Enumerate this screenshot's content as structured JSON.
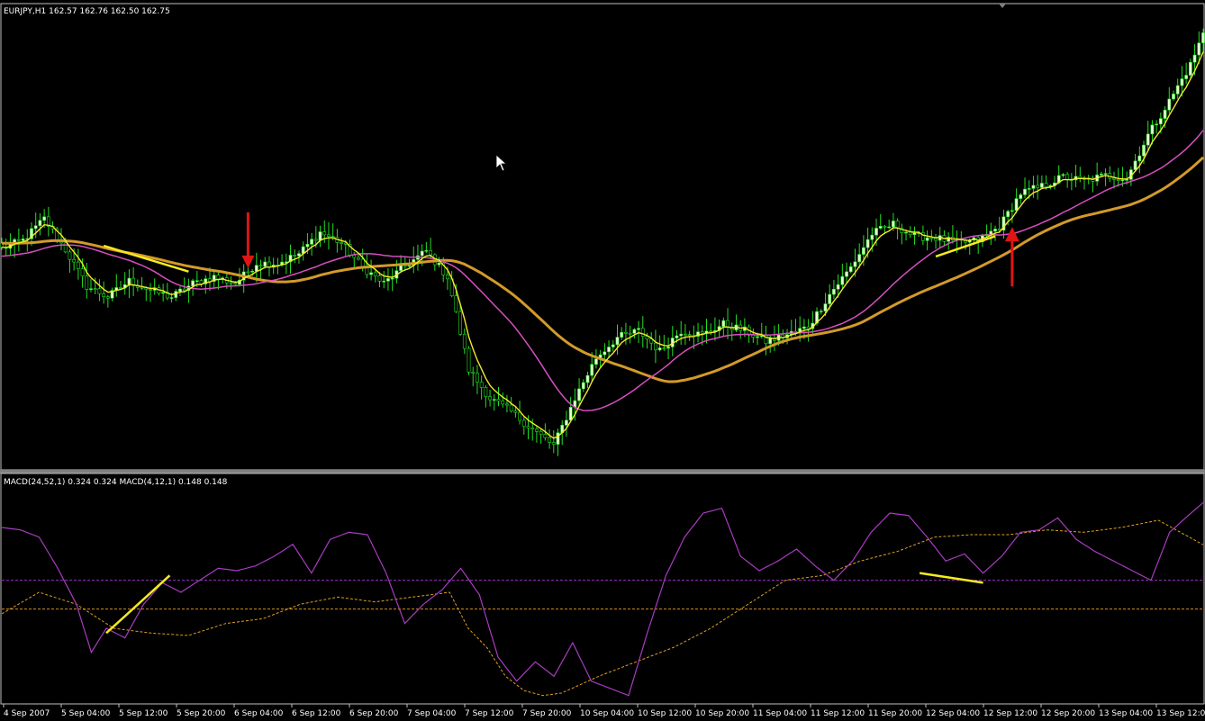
{
  "window": {
    "symbol_info": "EURJPY,H1  162.57 162.76 162.50 162.75",
    "indicator_info": "MACD(24,52,1) 0.324 0.324  MACD(4,12,1) 0.148 0.148"
  },
  "colors": {
    "background": "#000000",
    "frame": "#c0c0c0",
    "candle_up": "#e6ffd0",
    "candle_down": "#000000",
    "wick": "#22e022",
    "ma_fast": "#f2ea28",
    "ma_mid": "#d64fbf",
    "ma_slow": "#d39a2a",
    "annotation_line": "#f5ea20",
    "arrow": "#e11414",
    "macd_fast": "#a83cc0",
    "macd_slow": "#e0a020",
    "macd_level_upper": "#9b30c0",
    "macd_level_lower": "#d49020"
  },
  "chart_data": [
    {
      "type": "candlestick",
      "symbol": "EURJPY",
      "timeframe": "H1",
      "ohlc_header": {
        "open": 162.57,
        "high": 162.76,
        "low": 162.5,
        "close": 162.75
      },
      "x_tick_labels": [
        "4 Sep 2007",
        "5 Sep 04:00",
        "5 Sep 12:00",
        "5 Sep 20:00",
        "6 Sep 04:00",
        "6 Sep 12:00",
        "6 Sep 20:00",
        "7 Sep 04:00",
        "7 Sep 12:00",
        "7 Sep 20:00",
        "10 Sep 04:00",
        "10 Sep 12:00",
        "10 Sep 20:00",
        "11 Sep 04:00",
        "11 Sep 12:00",
        "11 Sep 20:00",
        "12 Sep 04:00",
        "12 Sep 12:00",
        "12 Sep 20:00",
        "13 Sep 04:00",
        "13 Sep 12:00"
      ],
      "y_range": [
        159.6,
        162.8
      ],
      "close_profile": [
        [
          0,
          161.16
        ],
        [
          5,
          161.22
        ],
        [
          10,
          161.38
        ],
        [
          15,
          161.15
        ],
        [
          20,
          160.88
        ],
        [
          25,
          160.8
        ],
        [
          30,
          160.92
        ],
        [
          35,
          160.85
        ],
        [
          40,
          160.8
        ],
        [
          45,
          160.9
        ],
        [
          50,
          160.95
        ],
        [
          55,
          160.9
        ],
        [
          60,
          161.05
        ],
        [
          65,
          161.05
        ],
        [
          70,
          161.12
        ],
        [
          75,
          161.28
        ],
        [
          80,
          161.2
        ],
        [
          85,
          161.02
        ],
        [
          90,
          160.9
        ],
        [
          95,
          161.03
        ],
        [
          100,
          161.14
        ],
        [
          105,
          160.95
        ],
        [
          110,
          160.26
        ],
        [
          115,
          160.05
        ],
        [
          120,
          159.95
        ],
        [
          125,
          159.82
        ],
        [
          130,
          159.7
        ],
        [
          135,
          160.05
        ],
        [
          140,
          160.35
        ],
        [
          145,
          160.5
        ],
        [
          150,
          160.55
        ],
        [
          155,
          160.4
        ],
        [
          160,
          160.55
        ],
        [
          165,
          160.52
        ],
        [
          170,
          160.6
        ],
        [
          175,
          160.55
        ],
        [
          180,
          160.47
        ],
        [
          185,
          160.52
        ],
        [
          190,
          160.58
        ],
        [
          195,
          160.82
        ],
        [
          200,
          161.02
        ],
        [
          205,
          161.27
        ],
        [
          210,
          161.34
        ],
        [
          215,
          161.25
        ],
        [
          220,
          161.24
        ],
        [
          225,
          161.2
        ],
        [
          230,
          161.22
        ],
        [
          235,
          161.32
        ],
        [
          240,
          161.57
        ],
        [
          245,
          161.62
        ],
        [
          250,
          161.69
        ],
        [
          255,
          161.66
        ],
        [
          260,
          161.7
        ],
        [
          265,
          161.68
        ],
        [
          270,
          162.0
        ],
        [
          275,
          162.25
        ],
        [
          280,
          162.52
        ],
        [
          283,
          162.75
        ]
      ],
      "moving_averages": [
        "fast",
        "mid",
        "slow"
      ],
      "annotations": [
        {
          "kind": "sell-arrow",
          "near": "5 Sep 20:00"
        },
        {
          "kind": "buy-arrow",
          "near": "12 Sep 12:00"
        }
      ]
    },
    {
      "type": "line",
      "title": "MACD(24,52,1) 0.324 0.324  MACD(4,12,1) 0.148 0.148",
      "series": [
        {
          "name": "MACD(24,52,1)",
          "last_value": 0.324
        },
        {
          "name": "MACD(4,12,1)",
          "last_value": 0.148
        }
      ],
      "x_tick_labels": [
        "4 Sep 2007",
        "5 Sep 04:00",
        "5 Sep 12:00",
        "5 Sep 20:00",
        "6 Sep 04:00",
        "6 Sep 12:00",
        "6 Sep 20:00",
        "7 Sep 04:00",
        "7 Sep 12:00",
        "7 Sep 20:00",
        "10 Sep 04:00",
        "10 Sep 12:00",
        "10 Sep 20:00",
        "11 Sep 04:00",
        "11 Sep 12:00",
        "11 Sep 20:00",
        "12 Sep 04:00",
        "12 Sep 12:00",
        "12 Sep 20:00",
        "13 Sep 04:00",
        "13 Sep 12:00"
      ],
      "y_range": [
        -0.5,
        0.4
      ],
      "fast_profile": [
        [
          0,
          0.22
        ],
        [
          5,
          0.21
        ],
        [
          10,
          0.18
        ],
        [
          15,
          0.05
        ],
        [
          20,
          -0.1
        ],
        [
          24,
          -0.3
        ],
        [
          28,
          -0.2
        ],
        [
          33,
          -0.24
        ],
        [
          38,
          -0.1
        ],
        [
          43,
          -0.01
        ],
        [
          48,
          -0.05
        ],
        [
          53,
          0.0
        ],
        [
          58,
          0.05
        ],
        [
          63,
          0.04
        ],
        [
          68,
          0.06
        ],
        [
          73,
          0.1
        ],
        [
          78,
          0.15
        ],
        [
          83,
          0.03
        ],
        [
          88,
          0.17
        ],
        [
          93,
          0.2
        ],
        [
          98,
          0.19
        ],
        [
          103,
          0.03
        ],
        [
          108,
          -0.18
        ],
        [
          113,
          -0.1
        ],
        [
          118,
          -0.04
        ],
        [
          123,
          0.05
        ],
        [
          128,
          -0.06
        ],
        [
          133,
          -0.32
        ],
        [
          138,
          -0.42
        ],
        [
          143,
          -0.34
        ],
        [
          148,
          -0.4
        ],
        [
          153,
          -0.26
        ],
        [
          158,
          -0.42
        ],
        [
          163,
          -0.45
        ],
        [
          168,
          -0.48
        ],
        [
          173,
          -0.22
        ],
        [
          178,
          0.02
        ],
        [
          183,
          0.18
        ],
        [
          188,
          0.28
        ],
        [
          193,
          0.3
        ],
        [
          198,
          0.1
        ],
        [
          203,
          0.04
        ],
        [
          208,
          0.08
        ],
        [
          213,
          0.13
        ],
        [
          218,
          0.06
        ],
        [
          223,
          0.0
        ],
        [
          228,
          0.08
        ],
        [
          233,
          0.2
        ],
        [
          238,
          0.28
        ],
        [
          243,
          0.27
        ],
        [
          248,
          0.18
        ],
        [
          253,
          0.08
        ],
        [
          258,
          0.11
        ],
        [
          263,
          0.03
        ],
        [
          268,
          0.1
        ],
        [
          273,
          0.2
        ],
        [
          278,
          0.21
        ],
        [
          283,
          0.26
        ],
        [
          288,
          0.17
        ],
        [
          293,
          0.12
        ],
        [
          298,
          0.08
        ],
        [
          303,
          0.04
        ],
        [
          308,
          0.0
        ],
        [
          313,
          0.2
        ],
        [
          318,
          0.27
        ],
        [
          322,
          0.324
        ]
      ],
      "slow_profile": [
        [
          0,
          -0.14
        ],
        [
          10,
          -0.05
        ],
        [
          20,
          -0.1
        ],
        [
          30,
          -0.2
        ],
        [
          40,
          -0.22
        ],
        [
          50,
          -0.23
        ],
        [
          60,
          -0.18
        ],
        [
          70,
          -0.16
        ],
        [
          80,
          -0.1
        ],
        [
          90,
          -0.07
        ],
        [
          100,
          -0.09
        ],
        [
          110,
          -0.07
        ],
        [
          120,
          -0.05
        ],
        [
          125,
          -0.2
        ],
        [
          130,
          -0.28
        ],
        [
          135,
          -0.4
        ],
        [
          140,
          -0.46
        ],
        [
          145,
          -0.48
        ],
        [
          150,
          -0.47
        ],
        [
          160,
          -0.4
        ],
        [
          170,
          -0.34
        ],
        [
          180,
          -0.28
        ],
        [
          190,
          -0.2
        ],
        [
          200,
          -0.1
        ],
        [
          210,
          0.0
        ],
        [
          220,
          0.02
        ],
        [
          230,
          0.08
        ],
        [
          240,
          0.12
        ],
        [
          250,
          0.18
        ],
        [
          260,
          0.19
        ],
        [
          270,
          0.19
        ],
        [
          280,
          0.21
        ],
        [
          290,
          0.2
        ],
        [
          300,
          0.22
        ],
        [
          310,
          0.25
        ],
        [
          322,
          0.148
        ]
      ],
      "levels": [
        0.0,
        -0.12
      ]
    }
  ]
}
